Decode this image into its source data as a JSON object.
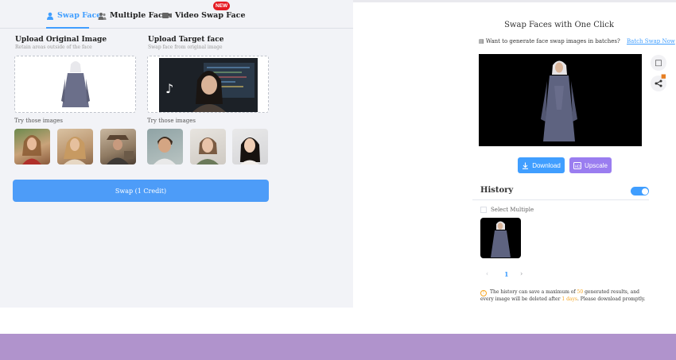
{
  "tabs": [
    {
      "label": "Swap Face",
      "icon": "person-icon",
      "active": true
    },
    {
      "label": "Multiple Faces",
      "icon": "group-icon",
      "active": false
    },
    {
      "label": "Video Swap Face",
      "icon": "video-icon",
      "active": false,
      "badge": "NEW"
    }
  ],
  "original": {
    "title": "Upload Original Image",
    "subtitle": "Retain areas outside of the face",
    "try_label": "Try those images"
  },
  "target": {
    "title": "Upload Target face",
    "subtitle": "Swap face from original image",
    "try_label": "Try those images"
  },
  "swap_button": "Swap (1 Credit)",
  "result": {
    "title": "Swap Faces with One Click",
    "batch_prompt": "Want to generate face swap images in batches?",
    "batch_link": "Batch Swap Now",
    "download_label": "Download",
    "upscale_label": "Upscale"
  },
  "history": {
    "title": "History",
    "select_multiple": "Select Multiple",
    "page_prev": "‹",
    "page_current": "1",
    "page_next": "›",
    "notice_a": "The history can save a maximum of ",
    "notice_max": "50",
    "notice_b": " generated results, and every image will be deleted after ",
    "notice_days": "1 days",
    "notice_c": ". Please download promptly."
  },
  "colors": {
    "accent": "#409eff",
    "upscale": "#9a7df0",
    "badge": "#e51c23",
    "footer": "#b093cc"
  }
}
